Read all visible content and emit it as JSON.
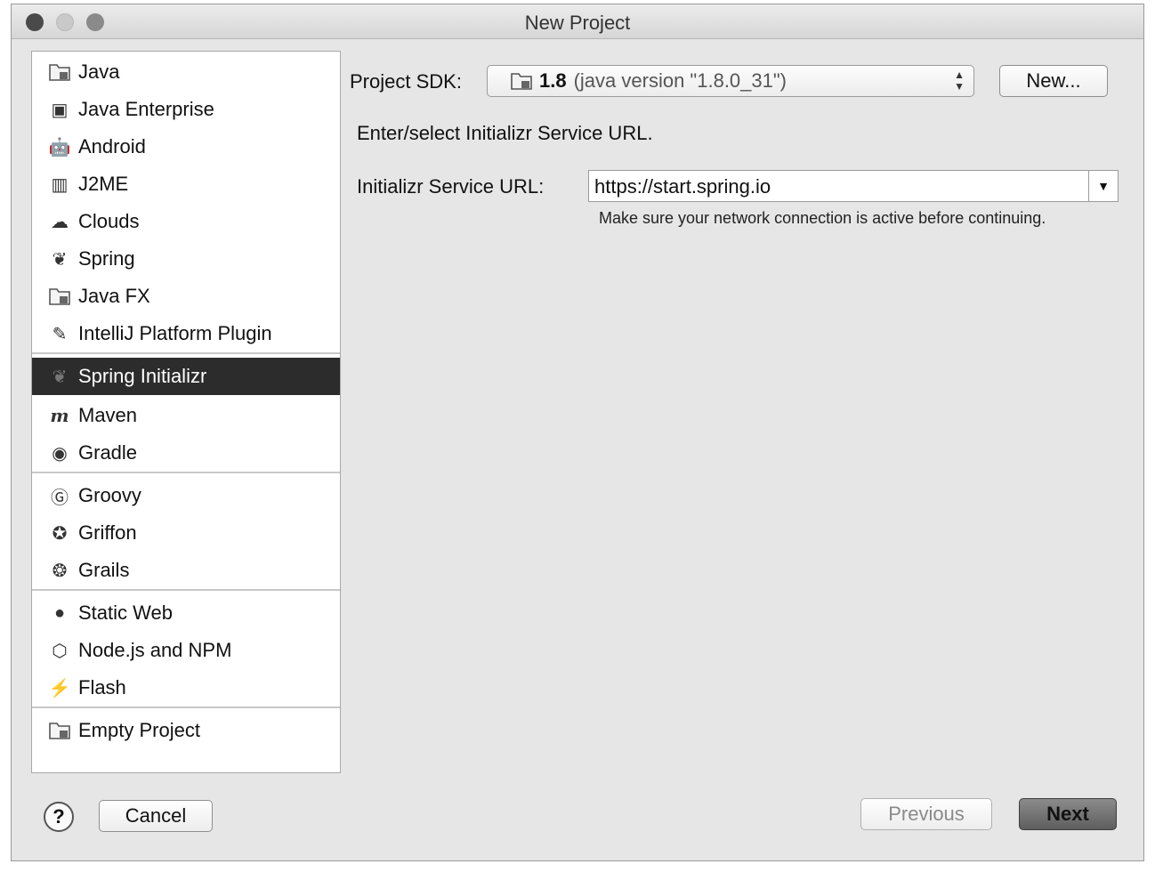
{
  "window": {
    "title": "New Project"
  },
  "sidebar": {
    "groups": [
      {
        "items": [
          {
            "label": "Java",
            "icon": "folder-icon"
          },
          {
            "label": "Java Enterprise",
            "icon": "java-enterprise-icon"
          },
          {
            "label": "Android",
            "icon": "android-icon"
          },
          {
            "label": "J2ME",
            "icon": "j2me-icon"
          },
          {
            "label": "Clouds",
            "icon": "clouds-icon"
          },
          {
            "label": "Spring",
            "icon": "spring-leaf-icon"
          },
          {
            "label": "Java FX",
            "icon": "folder-icon"
          },
          {
            "label": "IntelliJ Platform Plugin",
            "icon": "plugin-icon"
          }
        ]
      },
      {
        "items": [
          {
            "label": "Spring Initializr",
            "icon": "spring-initializr-icon",
            "selected": true
          },
          {
            "label": "Maven",
            "icon": "maven-icon"
          },
          {
            "label": "Gradle",
            "icon": "gradle-icon"
          }
        ]
      },
      {
        "items": [
          {
            "label": "Groovy",
            "icon": "groovy-icon"
          },
          {
            "label": "Griffon",
            "icon": "griffon-icon"
          },
          {
            "label": "Grails",
            "icon": "grails-icon"
          }
        ]
      },
      {
        "items": [
          {
            "label": "Static Web",
            "icon": "globe-icon"
          },
          {
            "label": "Node.js and NPM",
            "icon": "nodejs-icon"
          },
          {
            "label": "Flash",
            "icon": "flash-icon"
          }
        ]
      },
      {
        "items": [
          {
            "label": "Empty Project",
            "icon": "folder-icon"
          }
        ]
      }
    ]
  },
  "sdk": {
    "label": "Project SDK:",
    "version": "1.8",
    "detail": "(java version \"1.8.0_31\")",
    "new_button": "New..."
  },
  "initializr": {
    "heading": "Enter/select Initializr Service URL.",
    "url_label": "Initializr Service URL:",
    "url_value": "https://start.spring.io",
    "hint": "Make sure your network connection is active before continuing."
  },
  "footer": {
    "help": "?",
    "cancel": "Cancel",
    "previous": "Previous",
    "next": "Next"
  }
}
